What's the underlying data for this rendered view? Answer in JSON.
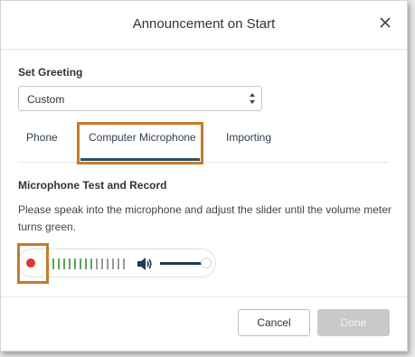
{
  "dialog": {
    "title": "Announcement on Start",
    "close_icon": "close-icon"
  },
  "greeting": {
    "label": "Set Greeting",
    "selected": "Custom"
  },
  "tabs": [
    {
      "label": "Phone"
    },
    {
      "label": "Computer Microphone",
      "active": true
    },
    {
      "label": "Importing"
    }
  ],
  "mic_test": {
    "heading": "Microphone Test and Record",
    "description": "Please speak into the microphone and adjust the slider until the volume meter turns green.",
    "record_icon": "record-dot-icon",
    "speaker_icon": "speaker-icon",
    "meter_green_bars": 8,
    "meter_total_bars": 14,
    "volume_level": 1.0
  },
  "footer": {
    "cancel_label": "Cancel",
    "done_label": "Done"
  },
  "colors": {
    "highlight": "#c47c2a",
    "record": "#e0342d",
    "meter_green": "#5aa85a",
    "meter_gray": "#9a9a9a",
    "accent": "#2f4d66"
  }
}
